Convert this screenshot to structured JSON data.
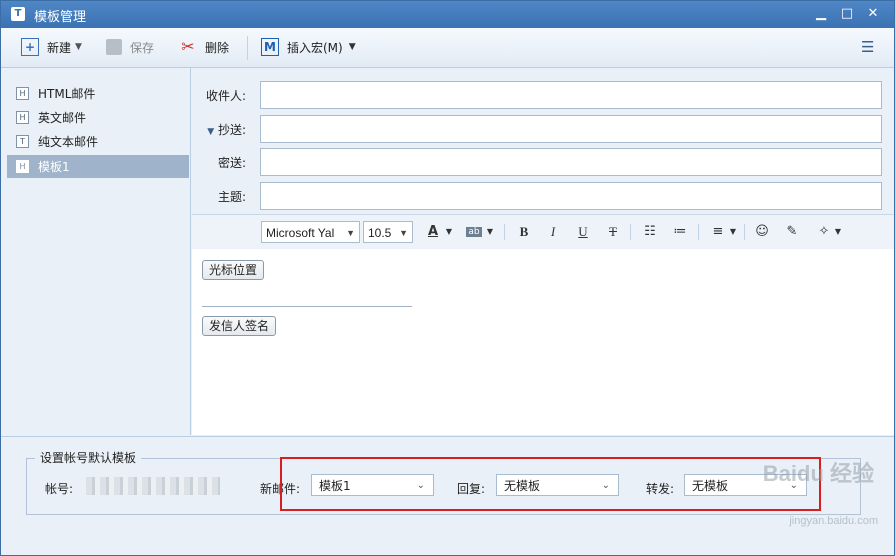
{
  "window": {
    "title": "模板管理",
    "minimize": "▁",
    "maximize": "□",
    "close": "✕"
  },
  "toolbar": {
    "new_label": "新建",
    "save_label": "保存",
    "delete_label": "删除",
    "insert_macro_label": "插入宏(M)",
    "new_icon": "plus-icon",
    "save_icon": "floppy-disk-icon",
    "delete_icon": "scissors-x-icon",
    "macro_icon": "m-icon",
    "menu_icon": "list-menu-icon"
  },
  "sidebar": {
    "items": [
      {
        "badge": "H",
        "label": "HTML邮件"
      },
      {
        "badge": "H",
        "label": "英文邮件"
      },
      {
        "badge": "T",
        "label": "纯文本邮件"
      },
      {
        "badge": "H",
        "label": "模板1",
        "selected": true
      }
    ]
  },
  "headers": {
    "to_label": "收件人:",
    "cc_label": "抄送:",
    "bcc_label": "密送:",
    "subject_label": "主题:",
    "to_value": "",
    "cc_value": "",
    "bcc_value": "",
    "subject_value": ""
  },
  "formatbar": {
    "font_family": "Microsoft Yal",
    "font_size": "10.5",
    "font_color": "A",
    "highlight": "ab",
    "bold": "B",
    "italic": "I",
    "underline": "U",
    "strike": "T"
  },
  "editor": {
    "cursor_button": "光标位置",
    "signature_button": "发信人签名"
  },
  "bottom": {
    "group_title": "设置帐号默认模板",
    "account_label": "帐号:",
    "new_mail_label": "新邮件:",
    "new_mail_value": "模板1",
    "reply_label": "回复:",
    "reply_value": "无模板",
    "forward_label": "转发:",
    "forward_value": "无模板"
  },
  "watermark": {
    "brand": "Baidu 经验",
    "url": "jingyan.baidu.com"
  },
  "colors": {
    "title_bar": "#3b72b3",
    "selected_item": "#9fb4ca",
    "highlight_box": "#d81e1e"
  }
}
